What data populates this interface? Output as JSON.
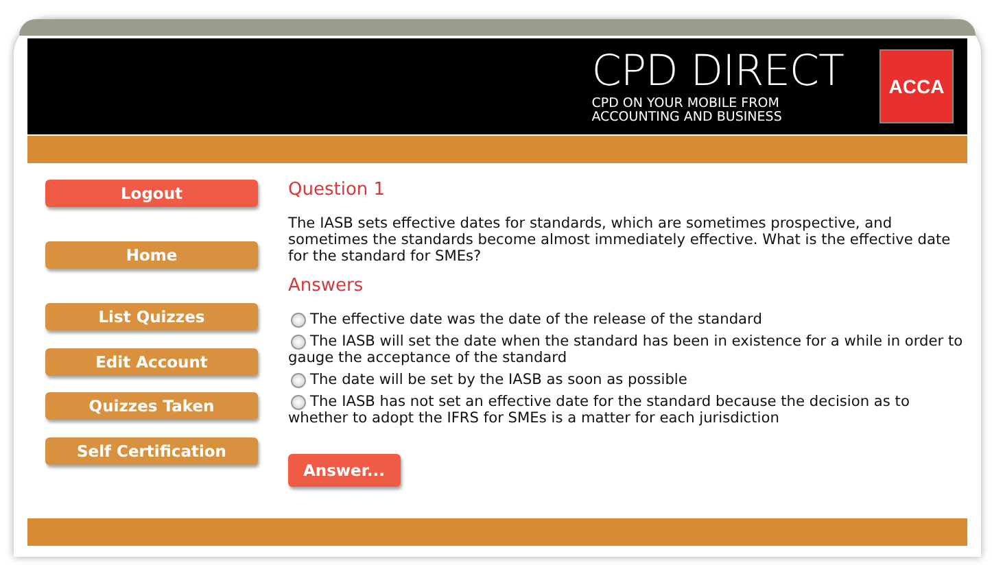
{
  "header": {
    "title": "CPD DIRECT",
    "subtitle_lines": [
      "CPD ON YOUR MOBILE FROM",
      "ACCOUNTING AND BUSINESS"
    ],
    "logo": "ACCA"
  },
  "sidebar": {
    "items": [
      {
        "label": "Logout",
        "kind": "danger"
      },
      {
        "label": "Home",
        "kind": "nav"
      },
      {
        "label": "List Quizzes",
        "kind": "nav"
      },
      {
        "label": "Edit Account",
        "kind": "nav"
      },
      {
        "label": "Quizzes Taken",
        "kind": "nav"
      },
      {
        "label": "Self Certification",
        "kind": "nav"
      }
    ]
  },
  "question": {
    "heading": "Question 1",
    "text": "The IASB sets effective dates for standards, which are sometimes prospective, and sometimes the standards become almost immediately effective. What is the effective date for the standard for SMEs?"
  },
  "answers": {
    "heading": "Answers",
    "options": [
      {
        "label": "The effective date was the date of the release of the standard",
        "selected": false
      },
      {
        "label": "The IASB will set the date when the standard has been in existence for a while in order to gauge the acceptance of the standard",
        "selected": false
      },
      {
        "label": "The date will be set by the IASB as soon as possible",
        "selected": false
      },
      {
        "label": "The IASB has not set an effective date for the standard because the decision as to whether to adopt the IFRS for SMEs is a matter for each jurisdiction",
        "selected": false
      }
    ]
  },
  "submit_button": "Answer..."
}
